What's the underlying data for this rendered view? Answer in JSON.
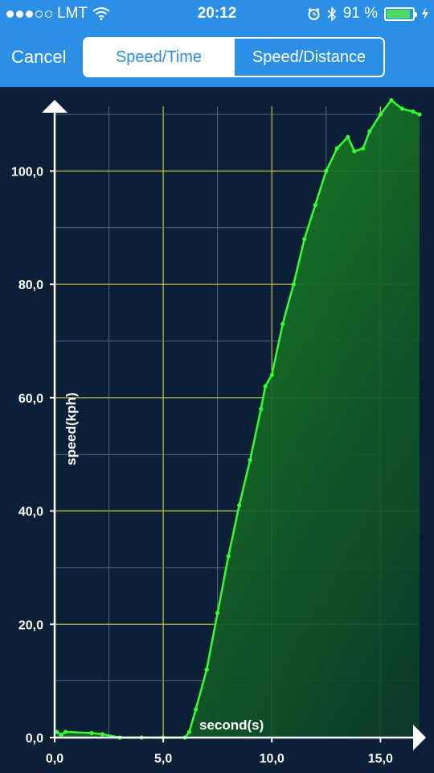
{
  "status_bar": {
    "carrier": "LMT",
    "time": "20:12",
    "battery": "91 %",
    "battery_level": 0.91
  },
  "nav": {
    "cancel_label": "Cancel",
    "tabs": [
      "Speed/Time",
      "Speed/Distance"
    ],
    "active_tab": 0
  },
  "chart_data": {
    "type": "area",
    "xlabel": "second(s)",
    "ylabel": "speed(kph)",
    "xlim": [
      0,
      16.8
    ],
    "ylim": [
      0,
      112
    ],
    "x_ticks": [
      0,
      5,
      10,
      15
    ],
    "x_tick_labels": [
      "0,0",
      "5,0",
      "10,0",
      "15,0"
    ],
    "y_ticks": [
      0,
      20,
      40,
      60,
      80,
      100
    ],
    "y_tick_labels": [
      "0,0",
      "20,0",
      "40,0",
      "60,0",
      "80,0",
      "100,0"
    ],
    "grid": true,
    "colors": {
      "line": "#33ff33",
      "fill": "#1a8a1a",
      "grid_major": "#b8b84a",
      "grid_minor": "#5f7384",
      "axis": "#ffffff"
    },
    "points": [
      [
        0.1,
        1
      ],
      [
        0.3,
        0.5
      ],
      [
        0.5,
        1
      ],
      [
        1.7,
        0.8
      ],
      [
        2.2,
        0.6
      ],
      [
        3.0,
        0
      ],
      [
        4.0,
        0
      ],
      [
        5.0,
        0
      ],
      [
        6.0,
        0
      ],
      [
        6.2,
        1
      ],
      [
        6.5,
        5
      ],
      [
        7.0,
        12
      ],
      [
        7.5,
        22
      ],
      [
        8.0,
        32
      ],
      [
        8.5,
        41
      ],
      [
        9.0,
        49
      ],
      [
        9.5,
        58
      ],
      [
        9.7,
        62
      ],
      [
        10.0,
        64
      ],
      [
        10.5,
        73
      ],
      [
        11.0,
        80
      ],
      [
        11.5,
        88
      ],
      [
        12.0,
        94
      ],
      [
        12.5,
        100
      ],
      [
        13.0,
        104
      ],
      [
        13.5,
        106
      ],
      [
        13.8,
        103.5
      ],
      [
        14.2,
        104
      ],
      [
        14.5,
        107
      ],
      [
        15.0,
        110
      ],
      [
        15.5,
        112.5
      ],
      [
        16.0,
        111
      ],
      [
        16.5,
        110.5
      ],
      [
        16.8,
        110
      ]
    ]
  }
}
